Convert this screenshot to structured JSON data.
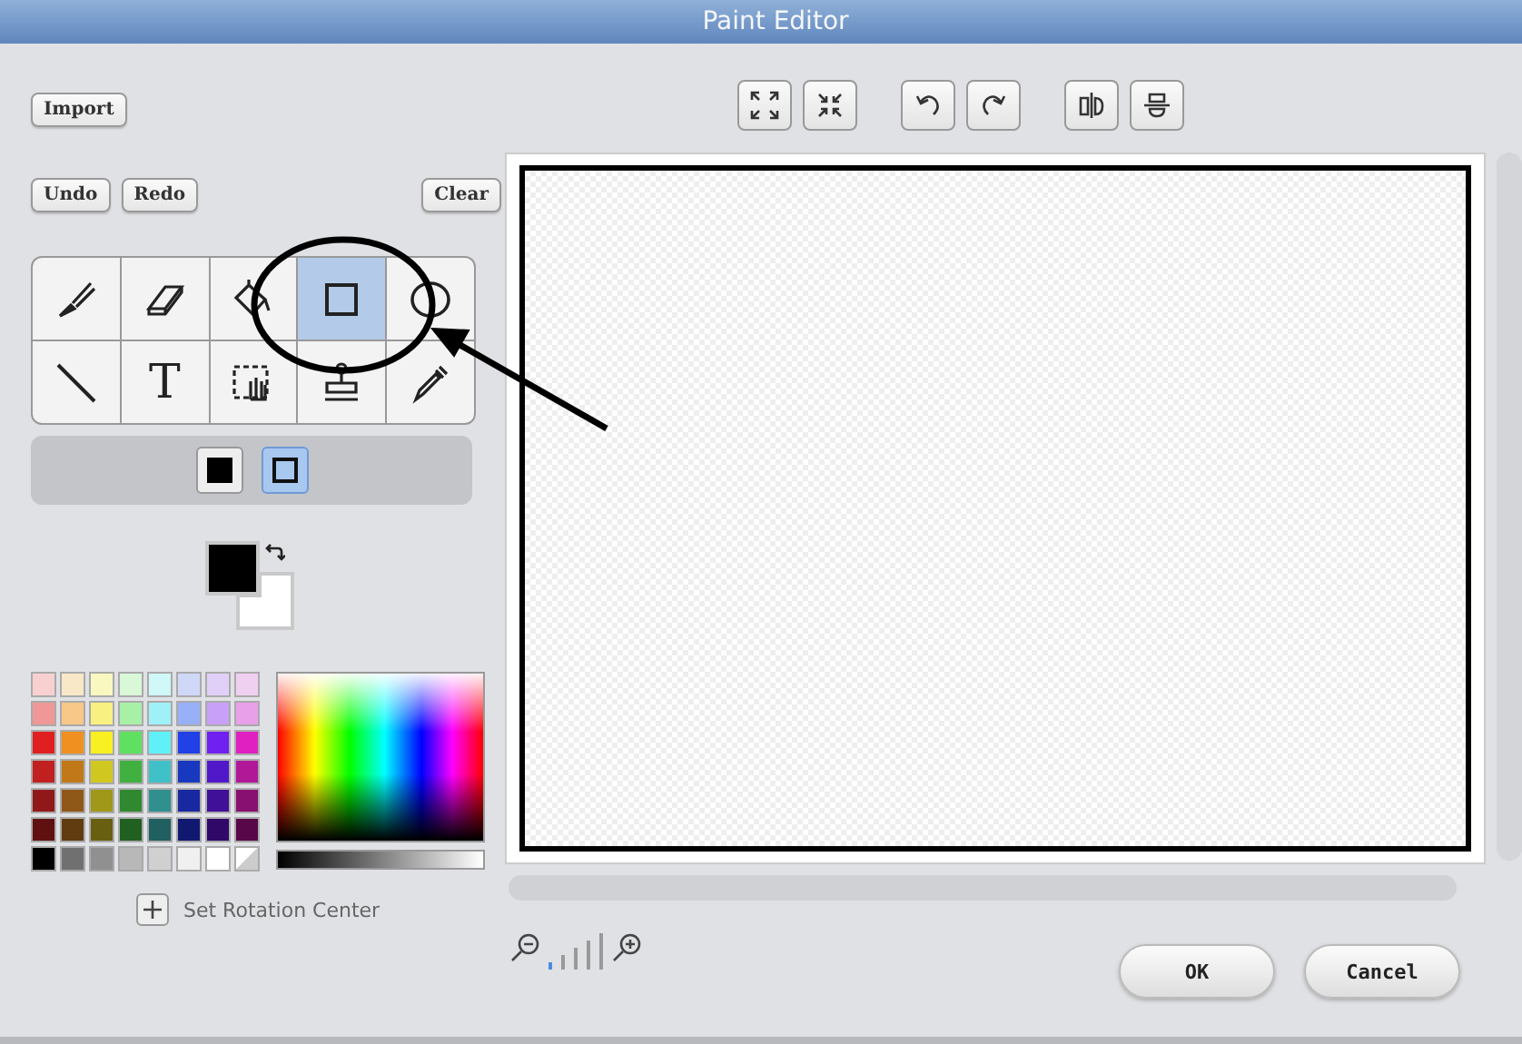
{
  "window": {
    "title": "Paint Editor"
  },
  "left_buttons": {
    "import": "Import",
    "undo": "Undo",
    "redo": "Redo",
    "clear": "Clear"
  },
  "tools": [
    {
      "kind": "brush",
      "selected": false
    },
    {
      "kind": "eraser",
      "selected": false
    },
    {
      "kind": "fill",
      "selected": false
    },
    {
      "kind": "rectangle",
      "selected": true
    },
    {
      "kind": "ellipse",
      "selected": false
    },
    {
      "kind": "line",
      "selected": false
    },
    {
      "kind": "text",
      "label": "T",
      "selected": false
    },
    {
      "kind": "select",
      "selected": false
    },
    {
      "kind": "stamp",
      "selected": false
    },
    {
      "kind": "eyedropper",
      "selected": false
    }
  ],
  "fill_modes": [
    {
      "kind": "filled",
      "selected": false
    },
    {
      "kind": "outline",
      "selected": true
    }
  ],
  "current_colors": [
    {
      "kind": "foreground",
      "color": "#000000"
    },
    {
      "kind": "background",
      "color": "#ffffff"
    }
  ],
  "palette": [
    [
      {
        "color": "#f8d0d0"
      },
      {
        "color": "#f8e8c8"
      },
      {
        "color": "#f8f8c0"
      },
      {
        "color": "#d8f8d8"
      },
      {
        "color": "#d0f8f8"
      },
      {
        "color": "#d0d8f8"
      },
      {
        "color": "#e0d0f8"
      },
      {
        "color": "#f0d0f0"
      }
    ],
    [
      {
        "color": "#f09898"
      },
      {
        "color": "#f8c888"
      },
      {
        "color": "#f8f080"
      },
      {
        "color": "#a8f0a8"
      },
      {
        "color": "#a0f0f8"
      },
      {
        "color": "#98b0f8"
      },
      {
        "color": "#c8a0f8"
      },
      {
        "color": "#e8a0e8"
      }
    ],
    [
      {
        "color": "#e02020"
      },
      {
        "color": "#f09020"
      },
      {
        "color": "#f8f020"
      },
      {
        "color": "#60e060"
      },
      {
        "color": "#60f0f8"
      },
      {
        "color": "#2040e8"
      },
      {
        "color": "#7020f0"
      },
      {
        "color": "#e020c0"
      }
    ],
    [
      {
        "color": "#c02020"
      },
      {
        "color": "#c07818"
      },
      {
        "color": "#d0c820"
      },
      {
        "color": "#40b040"
      },
      {
        "color": "#40c0c8"
      },
      {
        "color": "#1838c0"
      },
      {
        "color": "#5018c8"
      },
      {
        "color": "#b01898"
      }
    ],
    [
      {
        "color": "#901818"
      },
      {
        "color": "#905818"
      },
      {
        "color": "#a09818"
      },
      {
        "color": "#308830"
      },
      {
        "color": "#309090"
      },
      {
        "color": "#1828a0"
      },
      {
        "color": "#401098"
      },
      {
        "color": "#881070"
      }
    ],
    [
      {
        "color": "#601010"
      },
      {
        "color": "#603c10"
      },
      {
        "color": "#686010"
      },
      {
        "color": "#206020"
      },
      {
        "color": "#206060"
      },
      {
        "color": "#101870"
      },
      {
        "color": "#300868"
      },
      {
        "color": "#580848"
      }
    ],
    [
      {
        "color": "#000000"
      },
      {
        "color": "#707070"
      },
      {
        "color": "#909090"
      },
      {
        "color": "#b8b8b8"
      },
      {
        "color": "#d0d0d0"
      },
      {
        "color": "#f0f0f0"
      },
      {
        "color": "#ffffff"
      },
      {
        "kind": "transparent"
      }
    ]
  ],
  "rotation_center": {
    "label": "Set Rotation Center"
  },
  "toolbar": [
    {
      "kind": "grow"
    },
    {
      "kind": "shrink"
    },
    {
      "kind": "rotate-left"
    },
    {
      "kind": "rotate-right"
    },
    {
      "kind": "flip-horizontal"
    },
    {
      "kind": "flip-vertical"
    }
  ],
  "zoom_steps": [
    {
      "selected": true
    },
    {
      "selected": false
    },
    {
      "selected": false
    },
    {
      "selected": false
    },
    {
      "selected": false
    }
  ],
  "annotation": {
    "shown": true
  },
  "buttons": {
    "ok": "OK",
    "cancel": "Cancel"
  }
}
